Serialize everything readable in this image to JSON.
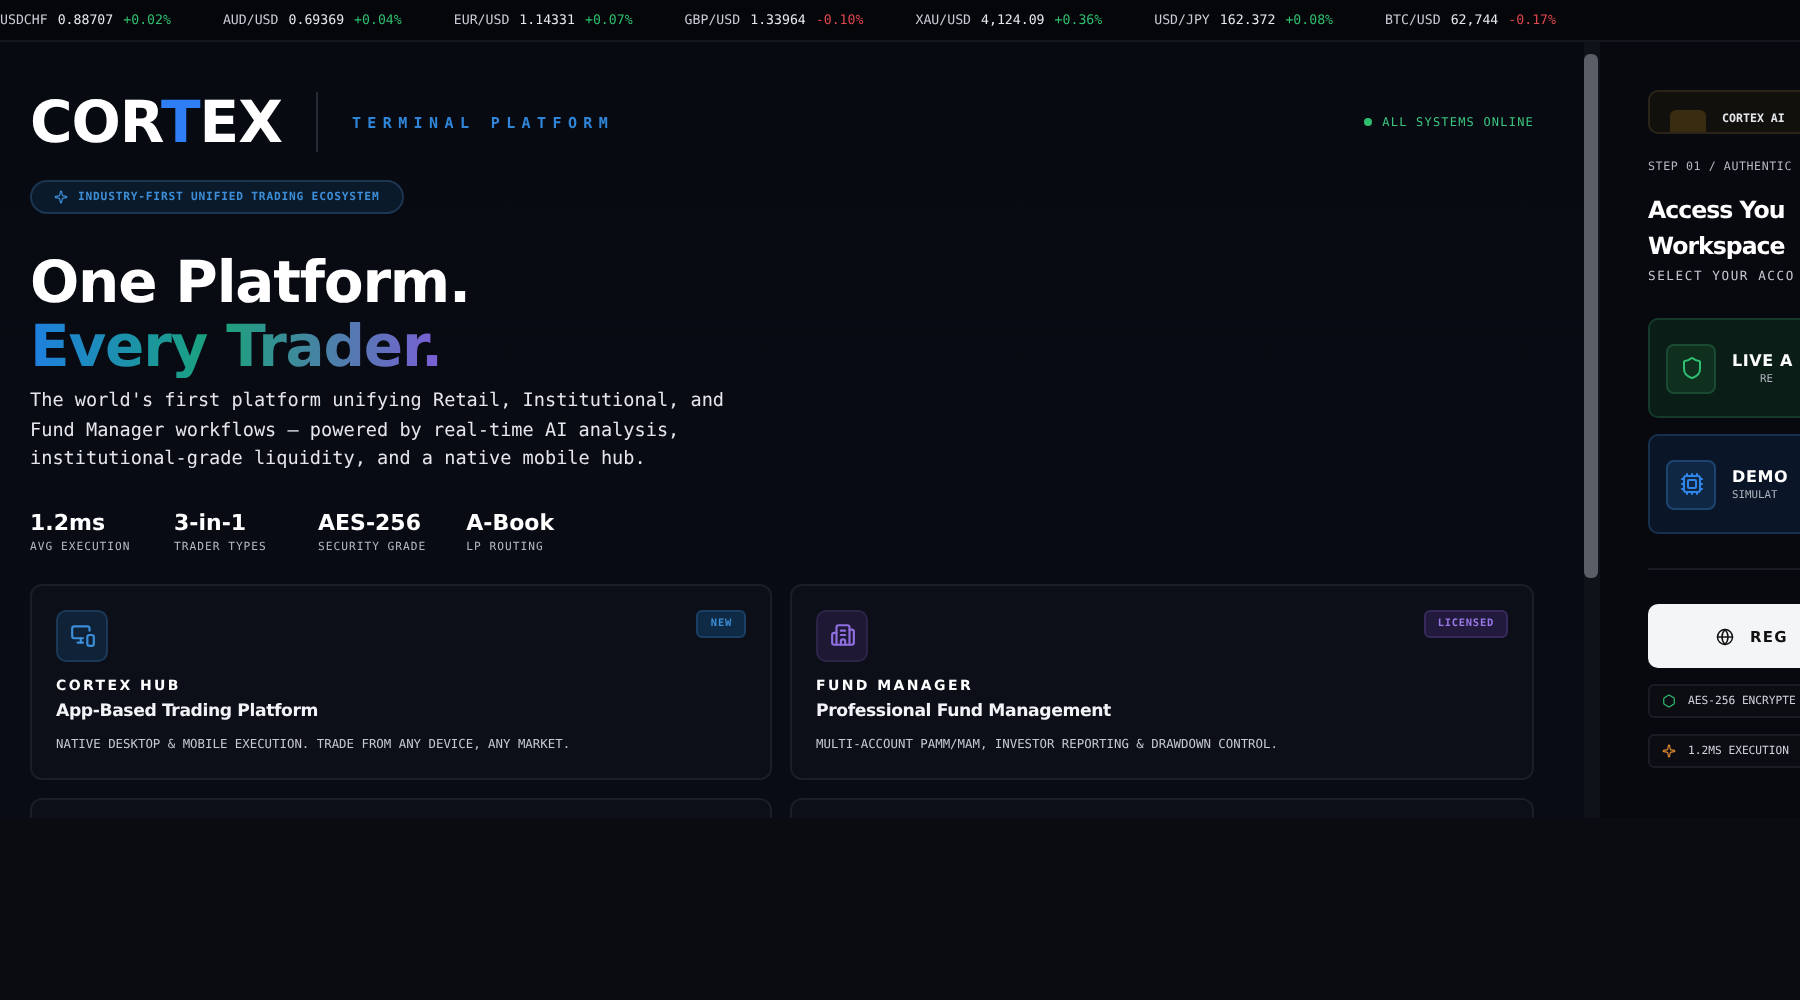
{
  "ticker": [
    {
      "symbol": "USDCHF",
      "price": "0.88707",
      "change": "+0.02%",
      "up": true
    },
    {
      "symbol": "AUD/USD",
      "price": "0.69369",
      "change": "+0.04%",
      "up": true
    },
    {
      "symbol": "EUR/USD",
      "price": "1.14331",
      "change": "+0.07%",
      "up": true
    },
    {
      "symbol": "GBP/USD",
      "price": "1.33964",
      "change": "-0.10%",
      "up": false
    },
    {
      "symbol": "XAU/USD",
      "price": "4,124.09",
      "change": "+0.36%",
      "up": true
    },
    {
      "symbol": "USD/JPY",
      "price": "162.372",
      "change": "+0.08%",
      "up": true
    },
    {
      "symbol": "BTC/USD",
      "price": "62,744",
      "change": "-0.17%",
      "up": false
    }
  ],
  "header": {
    "logo": {
      "before": "COR",
      "accent": "T",
      "after": "EX"
    },
    "tagline": "TERMINAL PLATFORM",
    "status": "ALL SYSTEMS ONLINE"
  },
  "hero": {
    "pill": "INDUSTRY-FIRST UNIFIED TRADING ECOSYSTEM",
    "title_line_1": "One Platform.",
    "title_line_2": "Every Trader.",
    "description": "The world's first platform unifying Retail, Institutional, and Fund Manager workflows — powered by real-time AI analysis, institutional-grade liquidity, and a native mobile hub.",
    "stats": [
      {
        "value": "1.2ms",
        "label": "AVG EXECUTION"
      },
      {
        "value": "3-in-1",
        "label": "TRADER TYPES"
      },
      {
        "value": "AES-256",
        "label": "SECURITY GRADE"
      },
      {
        "value": "A-Book",
        "label": "LP ROUTING"
      }
    ]
  },
  "cards": [
    {
      "kind": "hub",
      "badge": "NEW",
      "name": "CORTEX HUB",
      "title": "App-Based Trading Platform",
      "text": "NATIVE DESKTOP & MOBILE EXECUTION. TRADE FROM ANY DEVICE, ANY MARKET."
    },
    {
      "kind": "fund",
      "badge": "LICENSED",
      "name": "FUND MANAGER",
      "title": "Professional Fund Management",
      "text": "MULTI-ACCOUNT PAMM/MAM, INVESTOR REPORTING & DRAWDOWN CONTROL."
    }
  ],
  "side": {
    "ai_label": "CORTEX AI",
    "step": "STEP 01 / AUTHENTIC",
    "title_line_1": "Access You",
    "title_line_2": "Workspace",
    "subtitle": "SELECT YOUR ACCO",
    "accounts": [
      {
        "kind": "live",
        "title": "LIVE A",
        "sub": "RE"
      },
      {
        "kind": "demo",
        "title": "DEMO",
        "sub": "SIMULAT"
      }
    ],
    "button": "REG",
    "features": [
      {
        "kind": "secure",
        "text": "AES-256 ENCRYPTE"
      },
      {
        "kind": "speed",
        "text": "1.2MS EXECUTION"
      }
    ]
  }
}
